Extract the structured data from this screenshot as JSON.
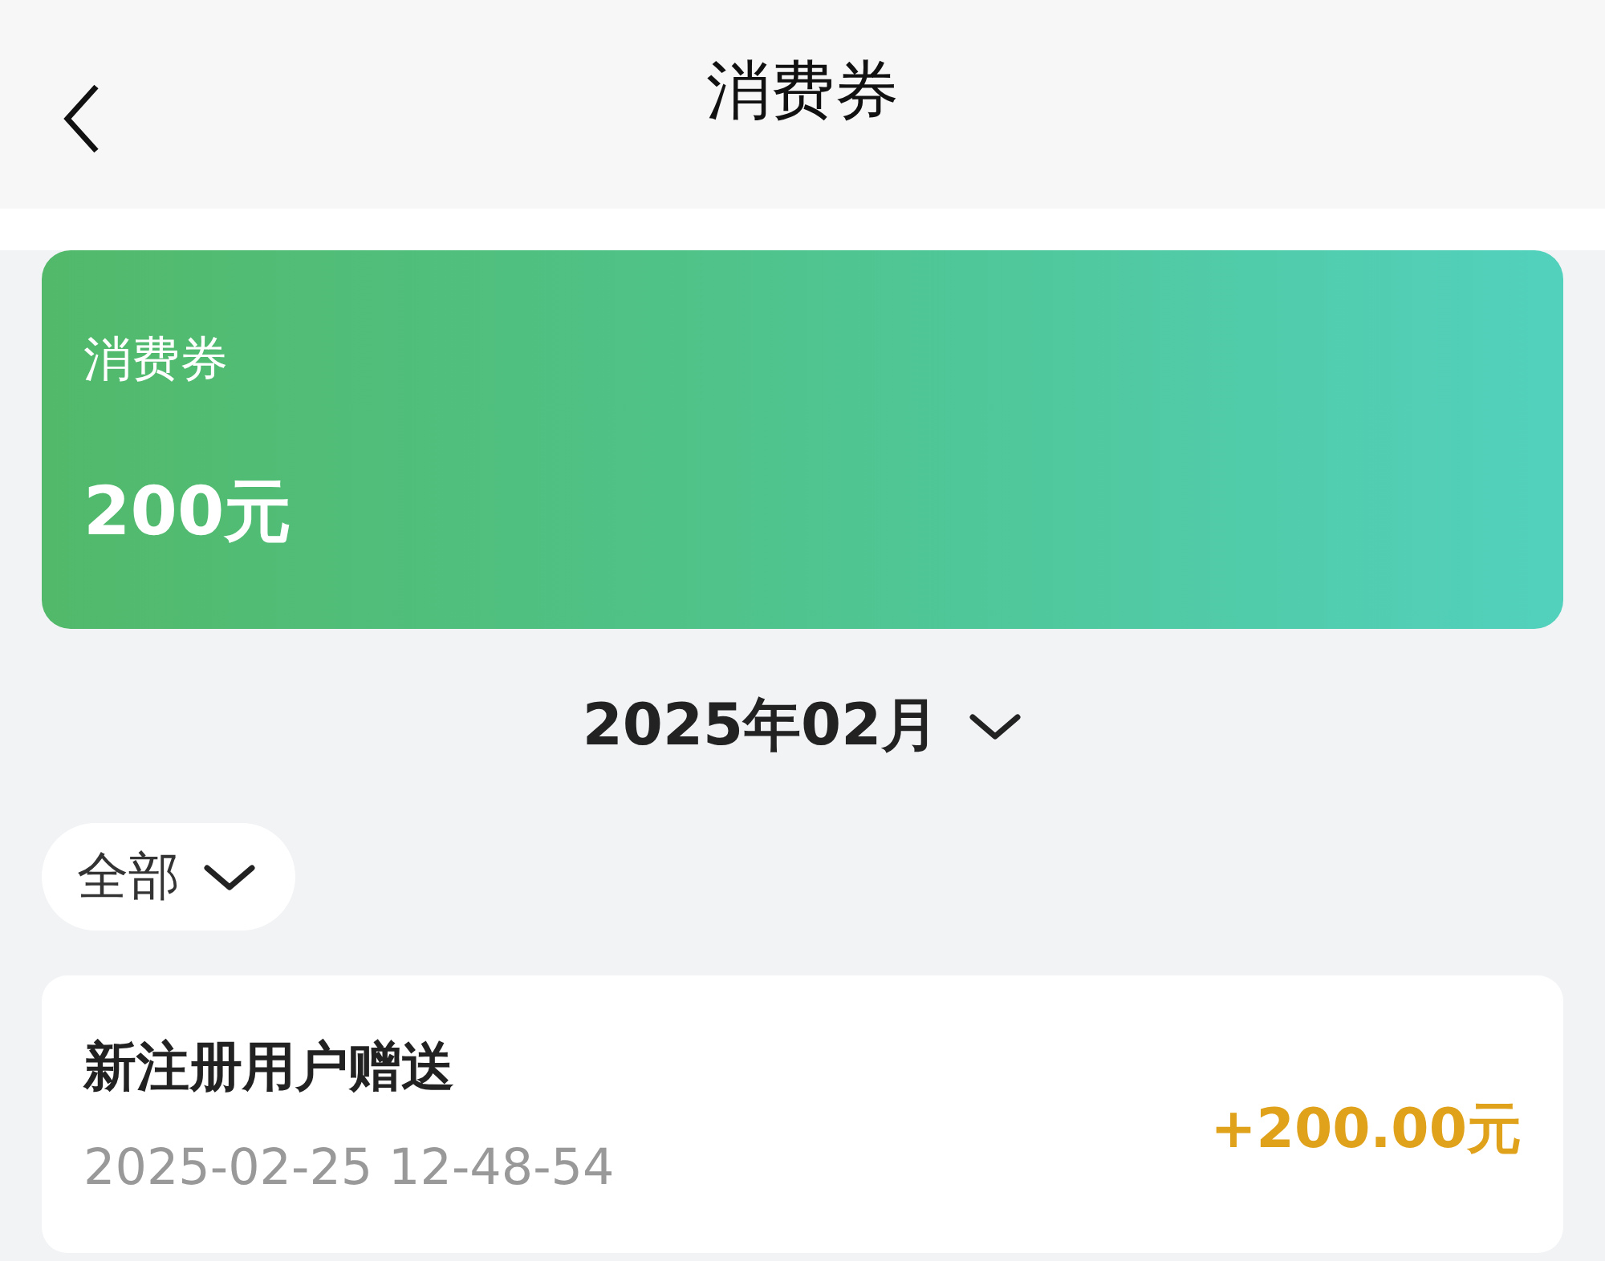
{
  "header": {
    "title": "消费券"
  },
  "balance_card": {
    "label": "消费券",
    "amount": "200元"
  },
  "month_picker": {
    "label": "2025年02月"
  },
  "filter": {
    "label": "全部"
  },
  "records": [
    {
      "title": "新注册用户赠送",
      "time": "2025-02-25 12-48-54",
      "amount": "+200.00元"
    }
  ]
}
